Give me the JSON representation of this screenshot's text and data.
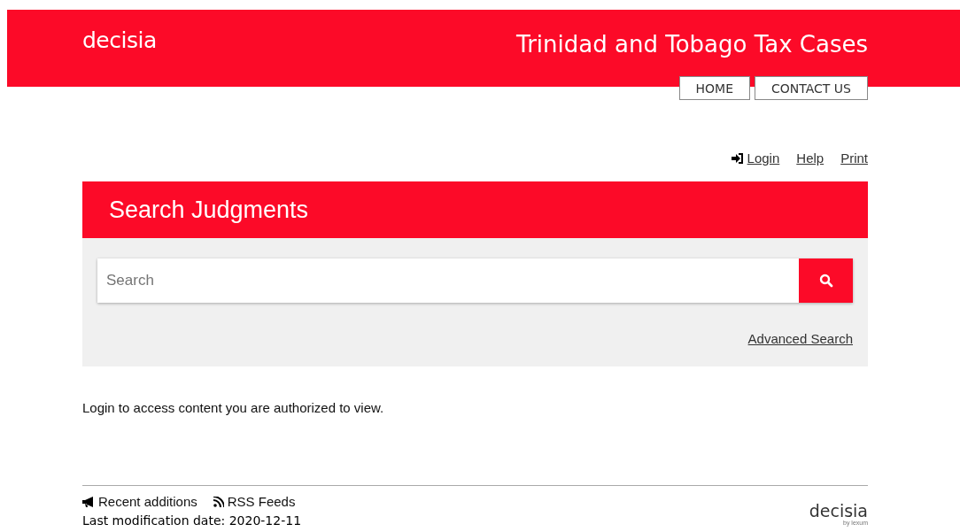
{
  "header": {
    "logo": "decisia",
    "title": "Trinidad and Tobago Tax Cases"
  },
  "nav": [
    {
      "label": "HOME"
    },
    {
      "label": "CONTACT US"
    }
  ],
  "user_links": [
    {
      "label": "Login",
      "kind": "login"
    },
    {
      "label": "Help",
      "kind": "plain"
    },
    {
      "label": "Print",
      "kind": "plain"
    }
  ],
  "search_panel": {
    "title": "Search Judgments",
    "placeholder": "Search",
    "advanced_link": "Advanced Search"
  },
  "notice": "Login to access content you are authorized to view.",
  "footer": {
    "links": [
      {
        "label": "Recent additions",
        "kind": "announce"
      },
      {
        "label": "RSS Feeds",
        "kind": "rss"
      }
    ],
    "modified": "Last modification date: 2020-12-11",
    "logo": "decisia",
    "logo_byline": "by lexum"
  }
}
